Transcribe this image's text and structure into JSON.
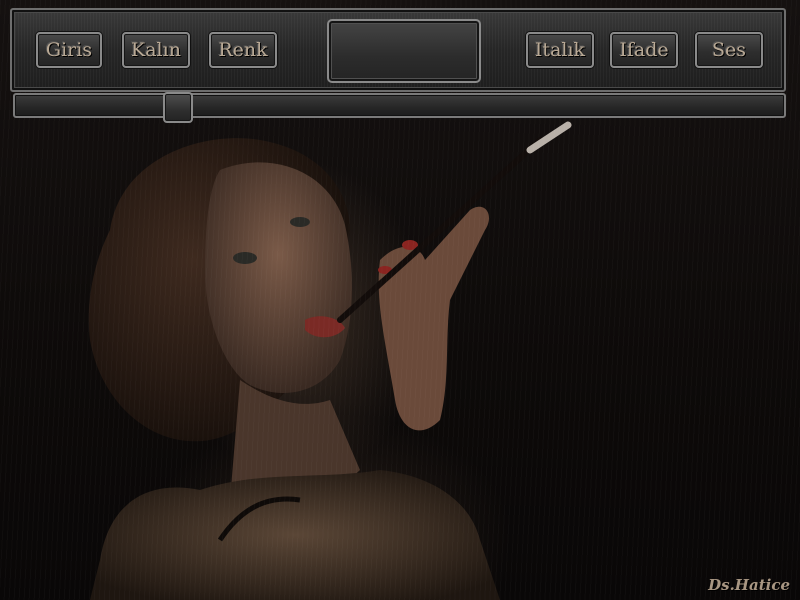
{
  "toolbar": {
    "buttons": [
      {
        "label": "Giris"
      },
      {
        "label": "Kalın"
      },
      {
        "label": "Renk"
      },
      {
        "label": "Italık"
      },
      {
        "label": "Ifade"
      },
      {
        "label": "Ses"
      }
    ]
  },
  "slider": {
    "value_fraction": 0.2
  },
  "signature": "Ds.Hatice",
  "colors": {
    "panel": "#2a2a2a",
    "button_text": "#b9a995",
    "background": "#0b0908"
  }
}
